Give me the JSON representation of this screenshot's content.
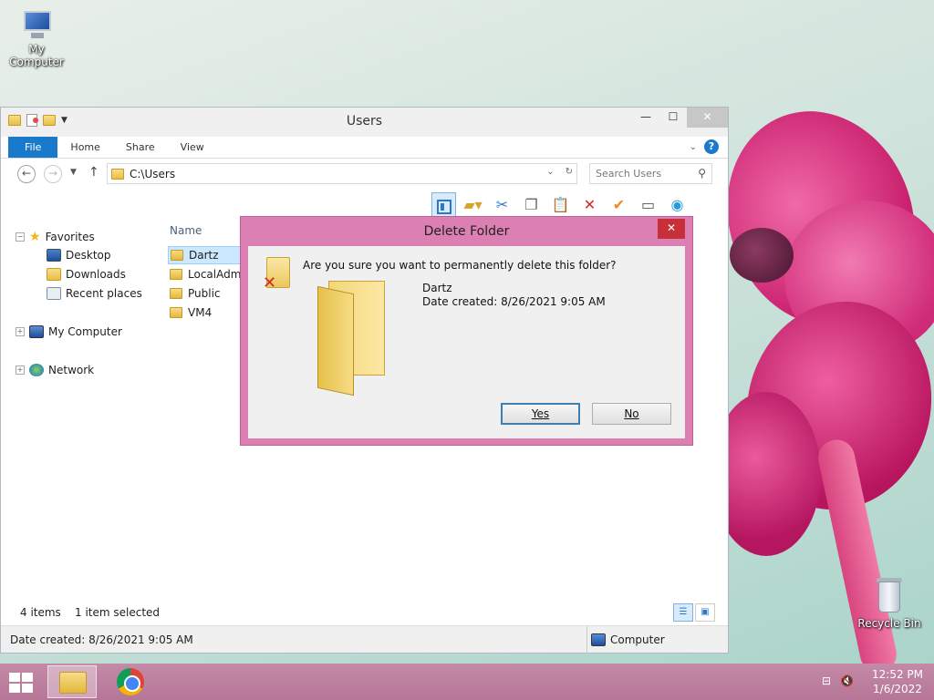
{
  "desktop": {
    "icons": [
      {
        "label": "My Computer",
        "icon": "computer-icon"
      },
      {
        "label": "Recycle Bin",
        "icon": "recycle-bin-icon"
      }
    ]
  },
  "window": {
    "title": "Users",
    "ribbon_tabs": [
      "File",
      "Home",
      "Share",
      "View"
    ],
    "address": "C:\\Users",
    "search_placeholder": "Search Users",
    "nav": {
      "favorites": "Favorites",
      "desktop": "Desktop",
      "downloads": "Downloads",
      "recent": "Recent places",
      "my_computer": "My Computer",
      "network": "Network"
    },
    "column_name": "Name",
    "files": [
      "Dartz",
      "LocalAdmin",
      "Public",
      "VM4"
    ],
    "selected_file": "Dartz",
    "status": {
      "items": "4 items",
      "selected": "1 item selected"
    },
    "details": {
      "date_created": "Date created: 8/26/2021 9:05 AM",
      "location": "Computer"
    }
  },
  "dialog": {
    "title": "Delete Folder",
    "question": "Are you sure you want to permanently delete this folder?",
    "folder_name": "Dartz",
    "date_created": "Date created: 8/26/2021 9:05 AM",
    "yes": "Yes",
    "no": "No"
  },
  "taskbar": {
    "time": "12:52 PM",
    "date": "1/6/2022"
  },
  "colors": {
    "accent": "#1979ca",
    "dialog_frame": "#dc7fb2",
    "taskbar": "#c48aa7"
  }
}
